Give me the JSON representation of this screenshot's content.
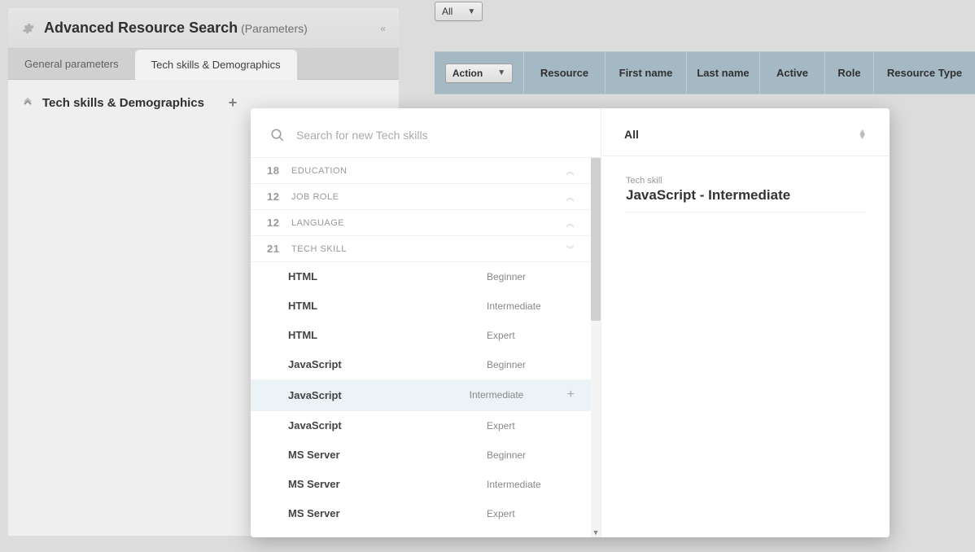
{
  "header": {
    "title": "Advanced Resource Search",
    "subtitle": "(Parameters)"
  },
  "tabs": [
    {
      "label": "General parameters",
      "active": false
    },
    {
      "label": "Tech skills & Demographics",
      "active": true
    }
  ],
  "section": {
    "title": "Tech skills & Demographics"
  },
  "topFilter": {
    "label": "All"
  },
  "tableHeaders": {
    "action": "Action",
    "resource": "Resource",
    "firstName": "First name",
    "lastName": "Last name",
    "active": "Active",
    "role": "Role",
    "resourceType": "Resource Type"
  },
  "popover": {
    "searchPlaceholder": "Search for new Tech skills",
    "categories": [
      {
        "count": "18",
        "name": "EDUCATION",
        "expanded": false
      },
      {
        "count": "12",
        "name": "JOB ROLE",
        "expanded": false
      },
      {
        "count": "12",
        "name": "LANGUAGE",
        "expanded": false
      },
      {
        "count": "21",
        "name": "TECH SKILL",
        "expanded": true
      }
    ],
    "skills": [
      {
        "name": "HTML",
        "level": "Beginner",
        "highlight": false
      },
      {
        "name": "HTML",
        "level": "Intermediate",
        "highlight": false
      },
      {
        "name": "HTML",
        "level": "Expert",
        "highlight": false
      },
      {
        "name": "JavaScript",
        "level": "Beginner",
        "highlight": false
      },
      {
        "name": "JavaScript",
        "level": "Intermediate",
        "highlight": true
      },
      {
        "name": "JavaScript",
        "level": "Expert",
        "highlight": false
      },
      {
        "name": "MS Server",
        "level": "Beginner",
        "highlight": false
      },
      {
        "name": "MS Server",
        "level": "Intermediate",
        "highlight": false
      },
      {
        "name": "MS Server",
        "level": "Expert",
        "highlight": false
      }
    ],
    "rightFilter": "All",
    "detail": {
      "label": "Tech skill",
      "title": "JavaScript - Intermediate"
    }
  }
}
